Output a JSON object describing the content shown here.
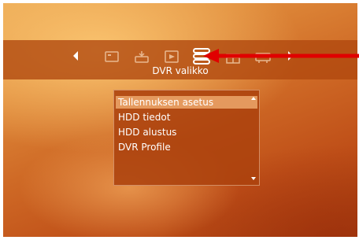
{
  "menu": {
    "title": "DVR valikko",
    "icons": [
      "left-arrow-icon",
      "tv-icon",
      "receiver-icon",
      "media-icon",
      "hdd-stack-icon",
      "gift-icon",
      "network-icon",
      "right-arrow-icon"
    ],
    "selected_icon": "hdd-stack-icon"
  },
  "list": {
    "items": [
      "Tallennuksen asetus",
      "HDD tiedot",
      "HDD alustus",
      "DVR Profile"
    ],
    "selected_index": 0
  },
  "colors": {
    "menubar": "#b0480e",
    "listbox": "#ac420e",
    "highlight": "#f5b478",
    "pointer_arrow": "#e00000"
  }
}
